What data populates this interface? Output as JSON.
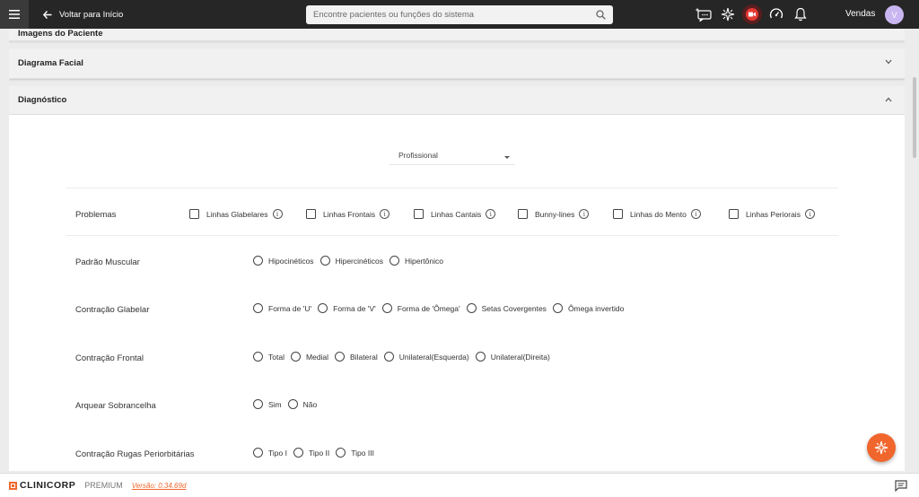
{
  "header": {
    "back_label": "Voltar para Início",
    "search_placeholder": "Encontre pacientes ou funções do sistema",
    "user_name": "Vendas",
    "avatar_initial": "V"
  },
  "panels": {
    "top_partial_title": "Imagens do Paciente",
    "facial_title": "Diagrama Facial",
    "diagnostico_title": "Diagnóstico"
  },
  "form": {
    "profissional_label": "Profissional",
    "problemas": {
      "label": "Problemas",
      "options": [
        "Linhas Glabelares",
        "Linhas Frontais",
        "Linhas Cantais",
        "Bunny-lines",
        "Linhas do Mento",
        "Linhas Periorais"
      ]
    },
    "padrao_muscular": {
      "label": "Padrão Muscular",
      "options": [
        "Hipocinéticos",
        "Hipercinéticos",
        "Hipertônico"
      ]
    },
    "contracao_glabelar": {
      "label": "Contração Glabelar",
      "options": [
        "Forma de 'U'",
        "Forma de 'V'",
        "Forma de 'Ômega'",
        "Setas Covergentes",
        "Ômega invertido"
      ]
    },
    "contracao_frontal": {
      "label": "Contração Frontal",
      "options": [
        "Total",
        "Medial",
        "Bilateral",
        "Unilateral(Esquerda)",
        "Unilateral(Direita)"
      ]
    },
    "arquear_sobrancelha": {
      "label": "Arquear Sobrancelha",
      "options": [
        "Sim",
        "Não"
      ]
    },
    "rugas_periorbitarias": {
      "label": "Contração Rugas Periorbitárias",
      "options": [
        "Tipo I",
        "Tipo II",
        "Tipo III"
      ]
    }
  },
  "footer": {
    "logo_text": "CLINICORP",
    "plan": "PREMIUM",
    "version": "Versão: 0.34.69d"
  },
  "colors": {
    "topbar": "#262626",
    "accent": "#f0662c",
    "avatar": "#c9b6f0"
  },
  "icons": [
    "menu-icon",
    "arrow-left-icon",
    "search-icon",
    "ai-chat-icon",
    "sparkle-icon",
    "record-icon",
    "speedometer-icon",
    "bell-icon",
    "chevron-down-icon",
    "chevron-up-icon",
    "info-icon",
    "chat-icon"
  ]
}
